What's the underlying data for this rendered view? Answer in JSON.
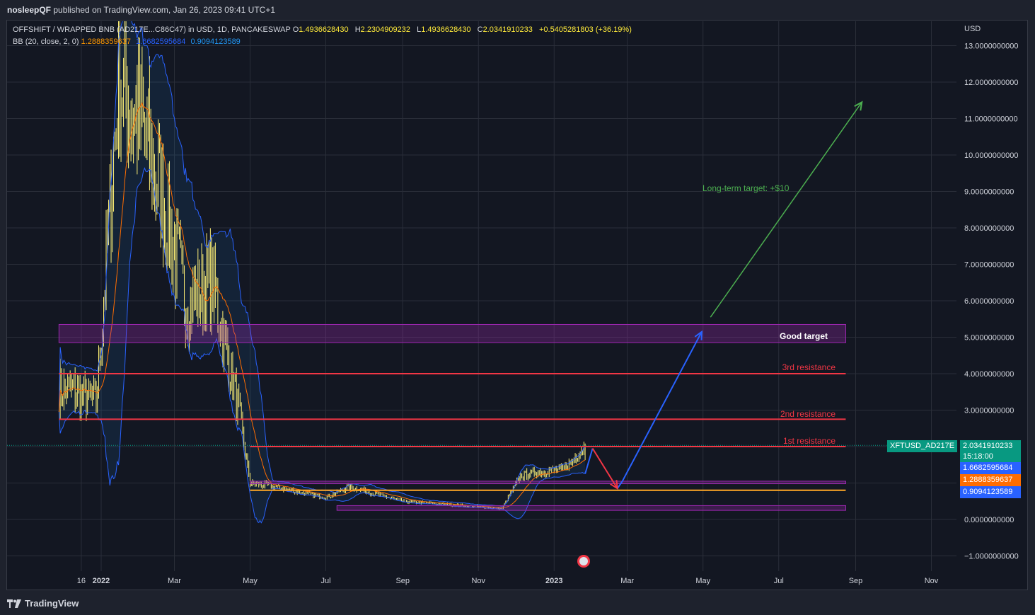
{
  "header": {
    "publisher": "nosleepQF",
    "published_text": "published on TradingView.com, Jan 26, 2023 09:41 UTC+1"
  },
  "legend": {
    "symbol": "OFFSHIFT / WRAPPED BNB (AD217E...C86C47) in USD, 1D, PANCAKESWAP",
    "open_label": "O",
    "open": "1.4936628430",
    "high_label": "H",
    "high": "2.2304909232",
    "low_label": "L",
    "low": "1.4936628430",
    "close_label": "C",
    "close": "2.0341910233",
    "change": "+0.5405281803 (+36.19%)",
    "bb_label": "BB (20, close, 2, 0)",
    "bb_basis": "1.2888359637",
    "bb_upper": "1.6682595684",
    "bb_lower": "0.9094123589"
  },
  "price_scale": {
    "currency": "USD",
    "ticks": [
      {
        "value": 13,
        "label": "13.0000000000"
      },
      {
        "value": 12,
        "label": "12.0000000000"
      },
      {
        "value": 11,
        "label": "11.0000000000"
      },
      {
        "value": 10,
        "label": "10.0000000000"
      },
      {
        "value": 9,
        "label": "9.0000000000"
      },
      {
        "value": 8,
        "label": "8.0000000000"
      },
      {
        "value": 7,
        "label": "7.0000000000"
      },
      {
        "value": 6,
        "label": "6.0000000000"
      },
      {
        "value": 5,
        "label": "5.0000000000"
      },
      {
        "value": 4,
        "label": "4.0000000000"
      },
      {
        "value": 3,
        "label": "3.0000000000"
      },
      {
        "value": 0,
        "label": "0.0000000000"
      },
      {
        "value": -1,
        "label": "−1.0000000000"
      }
    ]
  },
  "time_scale": {
    "ticks": [
      {
        "date": "2021-12-16",
        "label": "16"
      },
      {
        "date": "2022-01-01",
        "label": "2022"
      },
      {
        "date": "2022-03-01",
        "label": "Mar"
      },
      {
        "date": "2022-05-01",
        "label": "May"
      },
      {
        "date": "2022-07-01",
        "label": "Jul"
      },
      {
        "date": "2022-09-01",
        "label": "Sep"
      },
      {
        "date": "2022-11-01",
        "label": "Nov"
      },
      {
        "date": "2023-01-01",
        "label": "2023"
      },
      {
        "date": "2023-03-01",
        "label": "Mar"
      },
      {
        "date": "2023-05-01",
        "label": "May"
      },
      {
        "date": "2023-07-01",
        "label": "Jul"
      },
      {
        "date": "2023-09-01",
        "label": "Sep"
      },
      {
        "date": "2023-11-01",
        "label": "Nov"
      }
    ]
  },
  "price_tags": {
    "symbol_tag": "XFTUSD_AD217E",
    "close": "2.0341910233",
    "countdown": "15:18:00",
    "bb_upper": "1.6682595684",
    "bb_basis": "1.2888359637",
    "bb_lower": "0.9094123589"
  },
  "annotations": {
    "good_target": "Good target",
    "res3": "3rd resistance",
    "res2": "2nd resistance",
    "res1": "1st resistance",
    "long_term": "Long-term target: +$10"
  },
  "colors": {
    "background": "#131722",
    "candles": "#fff176",
    "bb_upper_lower": "#2962ff",
    "bb_basis": "#ff6d00",
    "resistance": "#f23645",
    "target_zone": "#9c27b0",
    "support_line": "#ffa726",
    "projection_up": "#2962ff",
    "projection_down": "#f23645",
    "long_term_arrow": "#4caf50",
    "close_tag": "#089981"
  },
  "footer": {
    "brand": "TradingView"
  },
  "chart_data": {
    "type": "candlestick",
    "title": "OFFSHIFT / WRAPPED BNB (AD217E...C86C47) in USD, 1D, PANCAKESWAP",
    "ylabel": "USD",
    "ylim": [
      -1.0,
      13.5
    ],
    "xlim": [
      "2021-11-28",
      "2023-11-25"
    ],
    "grid": true,
    "price_path": [
      {
        "date": "2021-11-28",
        "value": 3.6
      },
      {
        "date": "2021-12-10",
        "value": 3.5
      },
      {
        "date": "2021-12-28",
        "value": 3.2
      },
      {
        "date": "2022-01-03",
        "value": 6.0
      },
      {
        "date": "2022-01-15",
        "value": 12.0
      },
      {
        "date": "2022-02-01",
        "value": 11.0
      },
      {
        "date": "2022-02-18",
        "value": 9.0
      },
      {
        "date": "2022-03-10",
        "value": 6.0
      },
      {
        "date": "2022-04-01",
        "value": 6.5
      },
      {
        "date": "2022-04-20",
        "value": 3.3
      },
      {
        "date": "2022-05-01",
        "value": 1.0
      },
      {
        "date": "2022-05-20",
        "value": 0.9
      },
      {
        "date": "2022-07-01",
        "value": 0.6
      },
      {
        "date": "2022-07-20",
        "value": 0.9
      },
      {
        "date": "2022-09-01",
        "value": 0.5
      },
      {
        "date": "2022-11-20",
        "value": 0.3
      },
      {
        "date": "2022-12-05",
        "value": 1.2
      },
      {
        "date": "2022-12-20",
        "value": 1.3
      },
      {
        "date": "2023-01-10",
        "value": 1.4
      },
      {
        "date": "2023-01-26",
        "value": 2.03
      }
    ],
    "bollinger_bands": {
      "period": 20,
      "stddev": 2,
      "basis": 1.2888359637,
      "upper": 1.6682595684,
      "lower": 0.9094123589
    },
    "last": {
      "open": 1.493662843,
      "high": 2.2304909232,
      "low": 1.493662843,
      "close": 2.0341910233,
      "change": 0.5405281803,
      "change_pct": 36.19
    },
    "horizontal_levels": [
      {
        "name": "3rd resistance",
        "value": 4.0
      },
      {
        "name": "2nd resistance",
        "value": 2.75
      },
      {
        "name": "1st resistance",
        "value": 2.0
      },
      {
        "name": "support",
        "value": 0.8
      }
    ],
    "zones": [
      {
        "name": "Good target",
        "from": 4.85,
        "to": 5.35,
        "start": "2021-11-28",
        "end": "2023-08-24"
      },
      {
        "name": "",
        "from": 0.98,
        "to": 1.05,
        "start": "2022-05-01",
        "end": "2023-08-24"
      },
      {
        "name": "",
        "from": 0.25,
        "to": 0.38,
        "start": "2022-07-10",
        "end": "2023-08-24"
      }
    ],
    "projection_path": [
      {
        "date": "2023-02-01",
        "value": 1.95
      },
      {
        "date": "2023-02-21",
        "value": 0.85
      },
      {
        "date": "2023-02-25",
        "value": 1.05
      },
      {
        "date": "2023-04-30",
        "value": 5.15
      }
    ],
    "long_term_arrow": {
      "from": {
        "date": "2023-05-07",
        "value": 5.55
      },
      "to": {
        "date": "2023-09-06",
        "value": 11.45
      }
    }
  }
}
